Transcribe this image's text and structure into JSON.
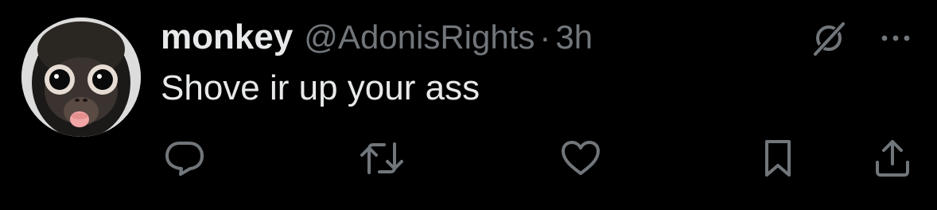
{
  "tweet": {
    "display_name": "monkey",
    "handle": "@AdonisRights",
    "separator": "·",
    "timestamp": "3h",
    "text": "Shove ir up your ass"
  },
  "avatar": {
    "description_icon": "monkey-avatar"
  },
  "icons": {
    "grok": "grok-icon",
    "more": "more-icon",
    "reply": "reply-icon",
    "retweet": "retweet-icon",
    "like": "like-icon",
    "bookmark": "bookmark-icon",
    "share": "share-icon"
  },
  "colors": {
    "background": "#000000",
    "primary_text": "#e7e9ea",
    "secondary_text": "#71767b"
  }
}
